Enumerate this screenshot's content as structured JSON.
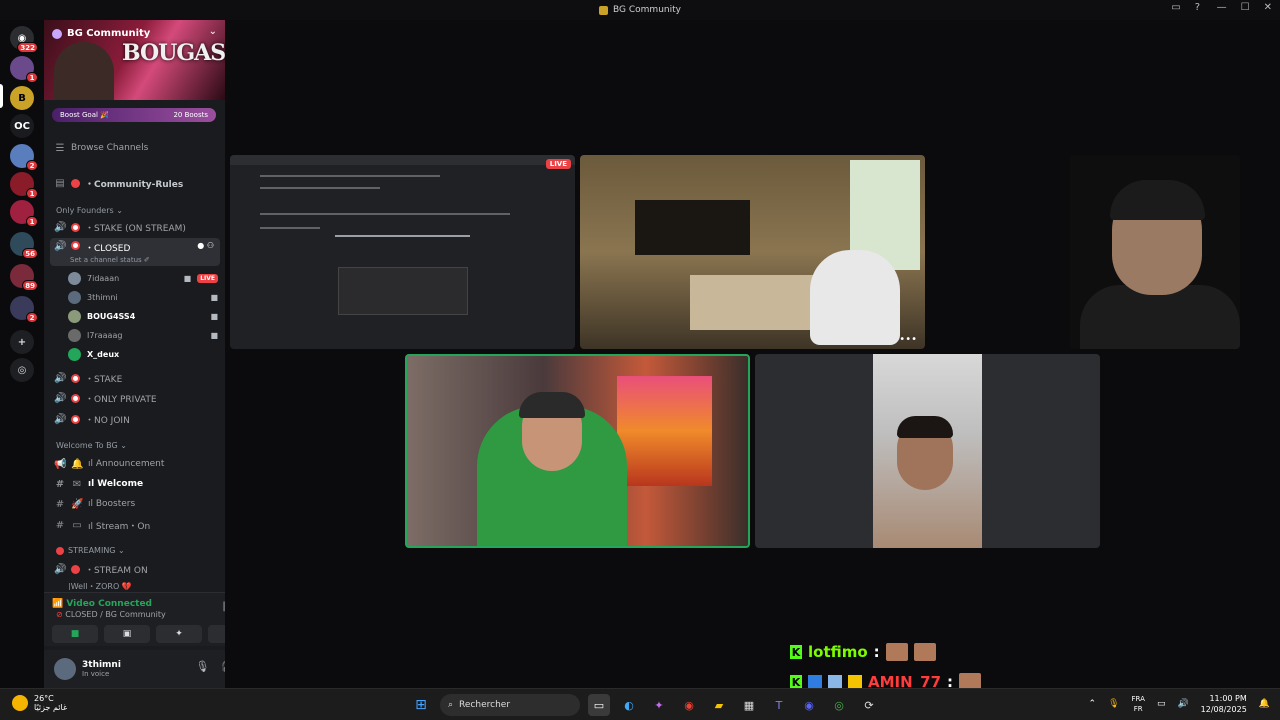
{
  "window": {
    "title": "BG Community"
  },
  "servers": {
    "home_badge": "322",
    "s1_badge": "1",
    "oc_label": "OC",
    "s3_badge": "2",
    "s4_badge": "1",
    "s5_badge": "1",
    "s6_badge": "56",
    "s7_badge": "89",
    "s8_badge": "2"
  },
  "guild": {
    "name": "BG Community",
    "banner_text": "BOUGASSAA",
    "boost_goal": "Boost Goal 🎉",
    "boost_count": "20 Boosts"
  },
  "channels": {
    "browse": "Browse Channels",
    "rules": "・Community-Rules",
    "cat_founders": "Only Founders ⌄",
    "stake_on_stream": "・STAKE (ON STREAM)",
    "closed": "・CLOSED",
    "closed_status": "Set a channel status ✐",
    "stake": "・STAKE",
    "only_private": "・ONLY PRIVATE",
    "no_join": "・NO JOIN",
    "cat_welcome": "Welcome To BG ⌄",
    "announcement": "ıl Announcement",
    "welcome": "ıl Welcome",
    "boosters": "ıl Boosters",
    "stream_on_text": "ıl Stream・On",
    "cat_streaming": "STREAMING ⌄",
    "stream_on": "・STREAM ON",
    "partial": "|WeIl・ZORO 💔"
  },
  "members": [
    {
      "name": "7idaaan",
      "live": "LIVE"
    },
    {
      "name": "3thimni"
    },
    {
      "name": "BOUG4SS4"
    },
    {
      "name": "I7raaaag"
    },
    {
      "name": "X_deux"
    }
  ],
  "voice": {
    "status": "Video Connected",
    "channel": "CLOSED / BG Community"
  },
  "user": {
    "name": "3thimni",
    "status": "In voice"
  },
  "stage": {
    "screen_live": "LIVE",
    "more": "•••"
  },
  "chat": {
    "line1_user": "lotfimo",
    "line1_sep": ":",
    "line2_user": "AMIN_77",
    "line2_sep": ":"
  },
  "taskbar": {
    "temp": "26°C",
    "weather_desc": "غائم جزئيًا",
    "search_placeholder": "Rechercher",
    "lang_top": "FRA",
    "lang_bottom": "FR",
    "time": "11:00 PM",
    "date": "12/08/2025"
  }
}
